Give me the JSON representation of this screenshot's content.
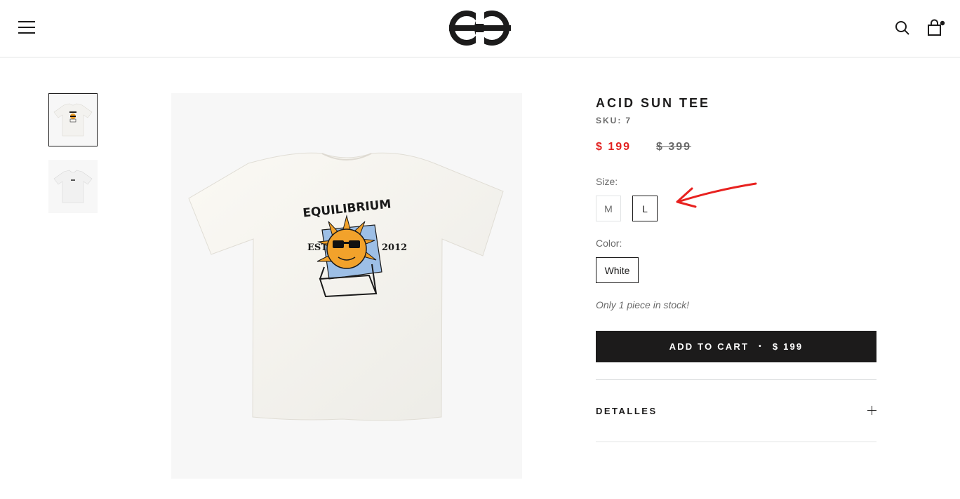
{
  "header": {
    "menu_icon": "hamburger-icon",
    "logo": "ee-logo",
    "search_icon": "search-icon",
    "cart_icon": "shopping-bag-icon"
  },
  "gallery": {
    "thumbnails": [
      "tshirt-back-thumbnail",
      "tshirt-front-thumbnail"
    ],
    "main_image": "tshirt-back-image",
    "graphic_text": {
      "brand": "EQUILIBRIUM",
      "est": "EST",
      "year": "2012"
    }
  },
  "product": {
    "title": "ACID SUN TEE",
    "sku_label": "SKU:",
    "sku_value": "7",
    "price": "$ 199",
    "compare_price": "$ 399",
    "size_label": "Size:",
    "sizes": [
      "M",
      "L"
    ],
    "selected_size": "L",
    "color_label": "Color:",
    "colors": [
      "White"
    ],
    "selected_color": "White",
    "stock_text": "Only 1 piece in stock!",
    "add_to_cart": {
      "label": "ADD TO CART",
      "separator": "•",
      "price": "$ 199"
    },
    "details_label": "DETALLES"
  },
  "colors": {
    "text": "#1c1b1b",
    "sale_price": "#e22120",
    "muted": "#6a6a6a",
    "border": "#e1e3e4",
    "annotation_arrow": "#e8211f"
  }
}
